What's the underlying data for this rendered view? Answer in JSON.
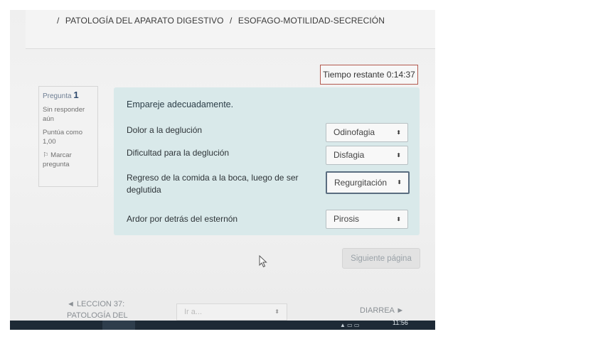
{
  "breadcrumb": [
    "/",
    "PATOLOGÍA DEL APARATO DIGESTIVO",
    "/",
    "ESOFAGO-MOTILIDAD-SECRECIÓN"
  ],
  "timer": "Tiempo restante 0:14:37",
  "question_info": {
    "label": "Pregunta",
    "number": "1",
    "status": "Sin responder aún",
    "score": "Puntúa como 1,00",
    "flag": "Marcar pregunta"
  },
  "question": {
    "text": "Empareje adecuadamente.",
    "rows": [
      {
        "label": "Dolor a la deglución",
        "selected": "Odinofagia"
      },
      {
        "label": "Dificultad para la deglución",
        "selected": "Disfagia"
      },
      {
        "label": "Regreso de la comida a la boca, luego de ser deglutida",
        "selected": "Regurgitación"
      },
      {
        "label": "Ardor por detrás del esternón",
        "selected": "Pirosis"
      }
    ]
  },
  "next_button": "Siguiente página",
  "footer": {
    "prev_link": "◄ LECCION 37: PATOLOGÍA DEL",
    "goto_placeholder": "Ir a...",
    "next_link": "DIARREA ►"
  },
  "taskbar": {
    "time": "11:56"
  },
  "icons": {
    "select_arrow": "⬍",
    "flag": "flag-icon",
    "cursor": "pointer-cursor"
  }
}
